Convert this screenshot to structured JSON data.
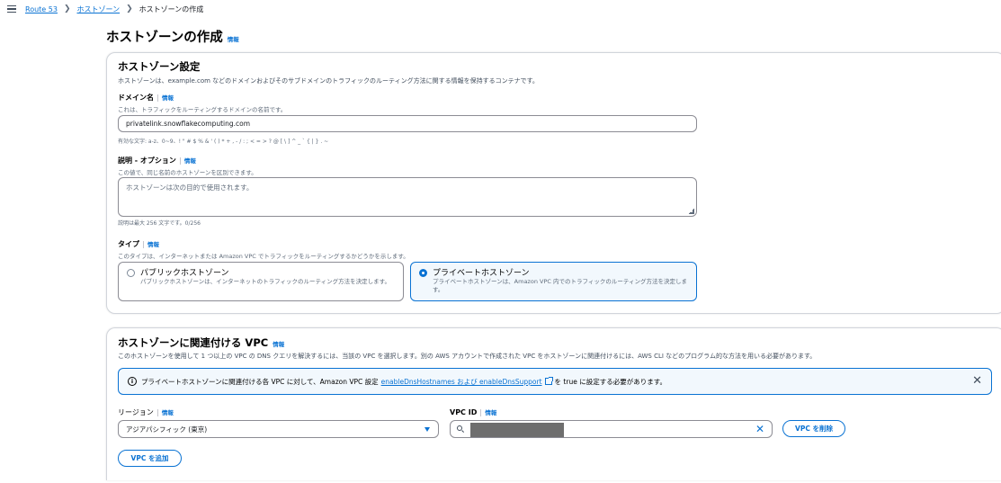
{
  "breadcrumb": {
    "items": [
      "Route 53",
      "ホストゾーン",
      "ホストゾーンの作成"
    ]
  },
  "page": {
    "title": "ホストゾーンの作成",
    "info": "情報"
  },
  "settings": {
    "title": "ホストゾーン設定",
    "description": "ホストゾーンは、example.com などのドメインおよびそのサブドメインのトラフィックのルーティング方法に関する情報を保持するコンテナです。",
    "domain": {
      "label": "ドメイン名",
      "info": "情報",
      "hint": "これは、トラフィックをルーティングするドメインの名前です。",
      "value": "privatelink.snowflakecomputing.com",
      "constraint": "有効な文字: a-z、0~9、! \" # $ % & ' ( ) * + , - / : ; < = > ? @ [ \\ ] ^ _ ` { | } . ~"
    },
    "description_field": {
      "label": "説明 - オプション",
      "info": "情報",
      "hint": "この値で、同じ名前のホストゾーンを区別できます。",
      "placeholder": "ホストゾーンは次の目的で使用されます。",
      "constraint": "説明は最大 256 文字です。0/256"
    },
    "type": {
      "label": "タイプ",
      "info": "情報",
      "hint": "このタイプは、インターネットまたは Amazon VPC でトラフィックをルーティングするかどうかを示します。",
      "options": [
        {
          "title": "パブリックホストゾーン",
          "desc": "パブリックホストゾーンは、インターネットのトラフィックのルーティング方法を決定します。",
          "selected": false
        },
        {
          "title": "プライベートホストゾーン",
          "desc": "プライベートホストゾーンは、Amazon VPC 内でのトラフィックのルーティング方法を決定します。",
          "selected": true
        }
      ]
    }
  },
  "vpc": {
    "title": "ホストゾーンに関連付ける VPC",
    "info": "情報",
    "description": "このホストゾーンを使用して 1 つ以上の VPC の DNS クエリを解決するには、当該の VPC を選択します。別の AWS アカウントで作成された VPC をホストゾーンに関連付けるには、AWS CLI などのプログラム的な方法を用いる必要があります。",
    "alert": {
      "text_before": "プライベートホストゾーンに関連付ける各 VPC に対して、Amazon VPC 設定",
      "link": "enableDnsHostnames および enableDnsSupport",
      "text_after": "を true に設定する必要があります。"
    },
    "region": {
      "label": "リージョン",
      "info": "情報",
      "value": "アジアパシフィック (東京)"
    },
    "vpc_id": {
      "label": "VPC ID",
      "info": "情報"
    },
    "remove_button": "VPC を削除",
    "add_button": "VPC を追加"
  }
}
